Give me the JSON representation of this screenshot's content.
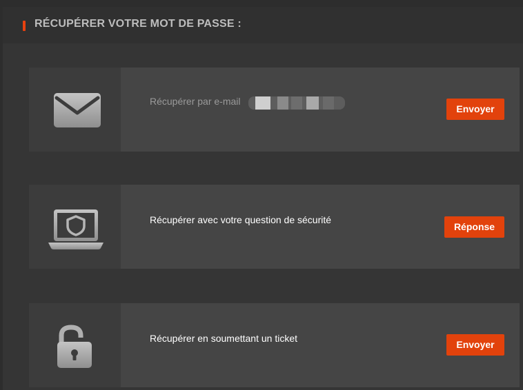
{
  "header": {
    "title": "RÉCUPÉRER VOTRE MOT DE PASSE :"
  },
  "options": [
    {
      "icon": "envelope-icon",
      "label": "Récupérer par e-mail",
      "masked_email": true,
      "button_label": "Envoyer"
    },
    {
      "icon": "laptop-shield-icon",
      "label": "Récupérer avec votre question de sécurité",
      "button_label": "Réponse"
    },
    {
      "icon": "unlocked-padlock-icon",
      "label": "Récupérer en soumettant un ticket",
      "button_label": "Envoyer"
    }
  ],
  "colors": {
    "accent": "#e2420c",
    "background": "#353535",
    "card": "#454545",
    "icon": "#a8a8a8"
  }
}
